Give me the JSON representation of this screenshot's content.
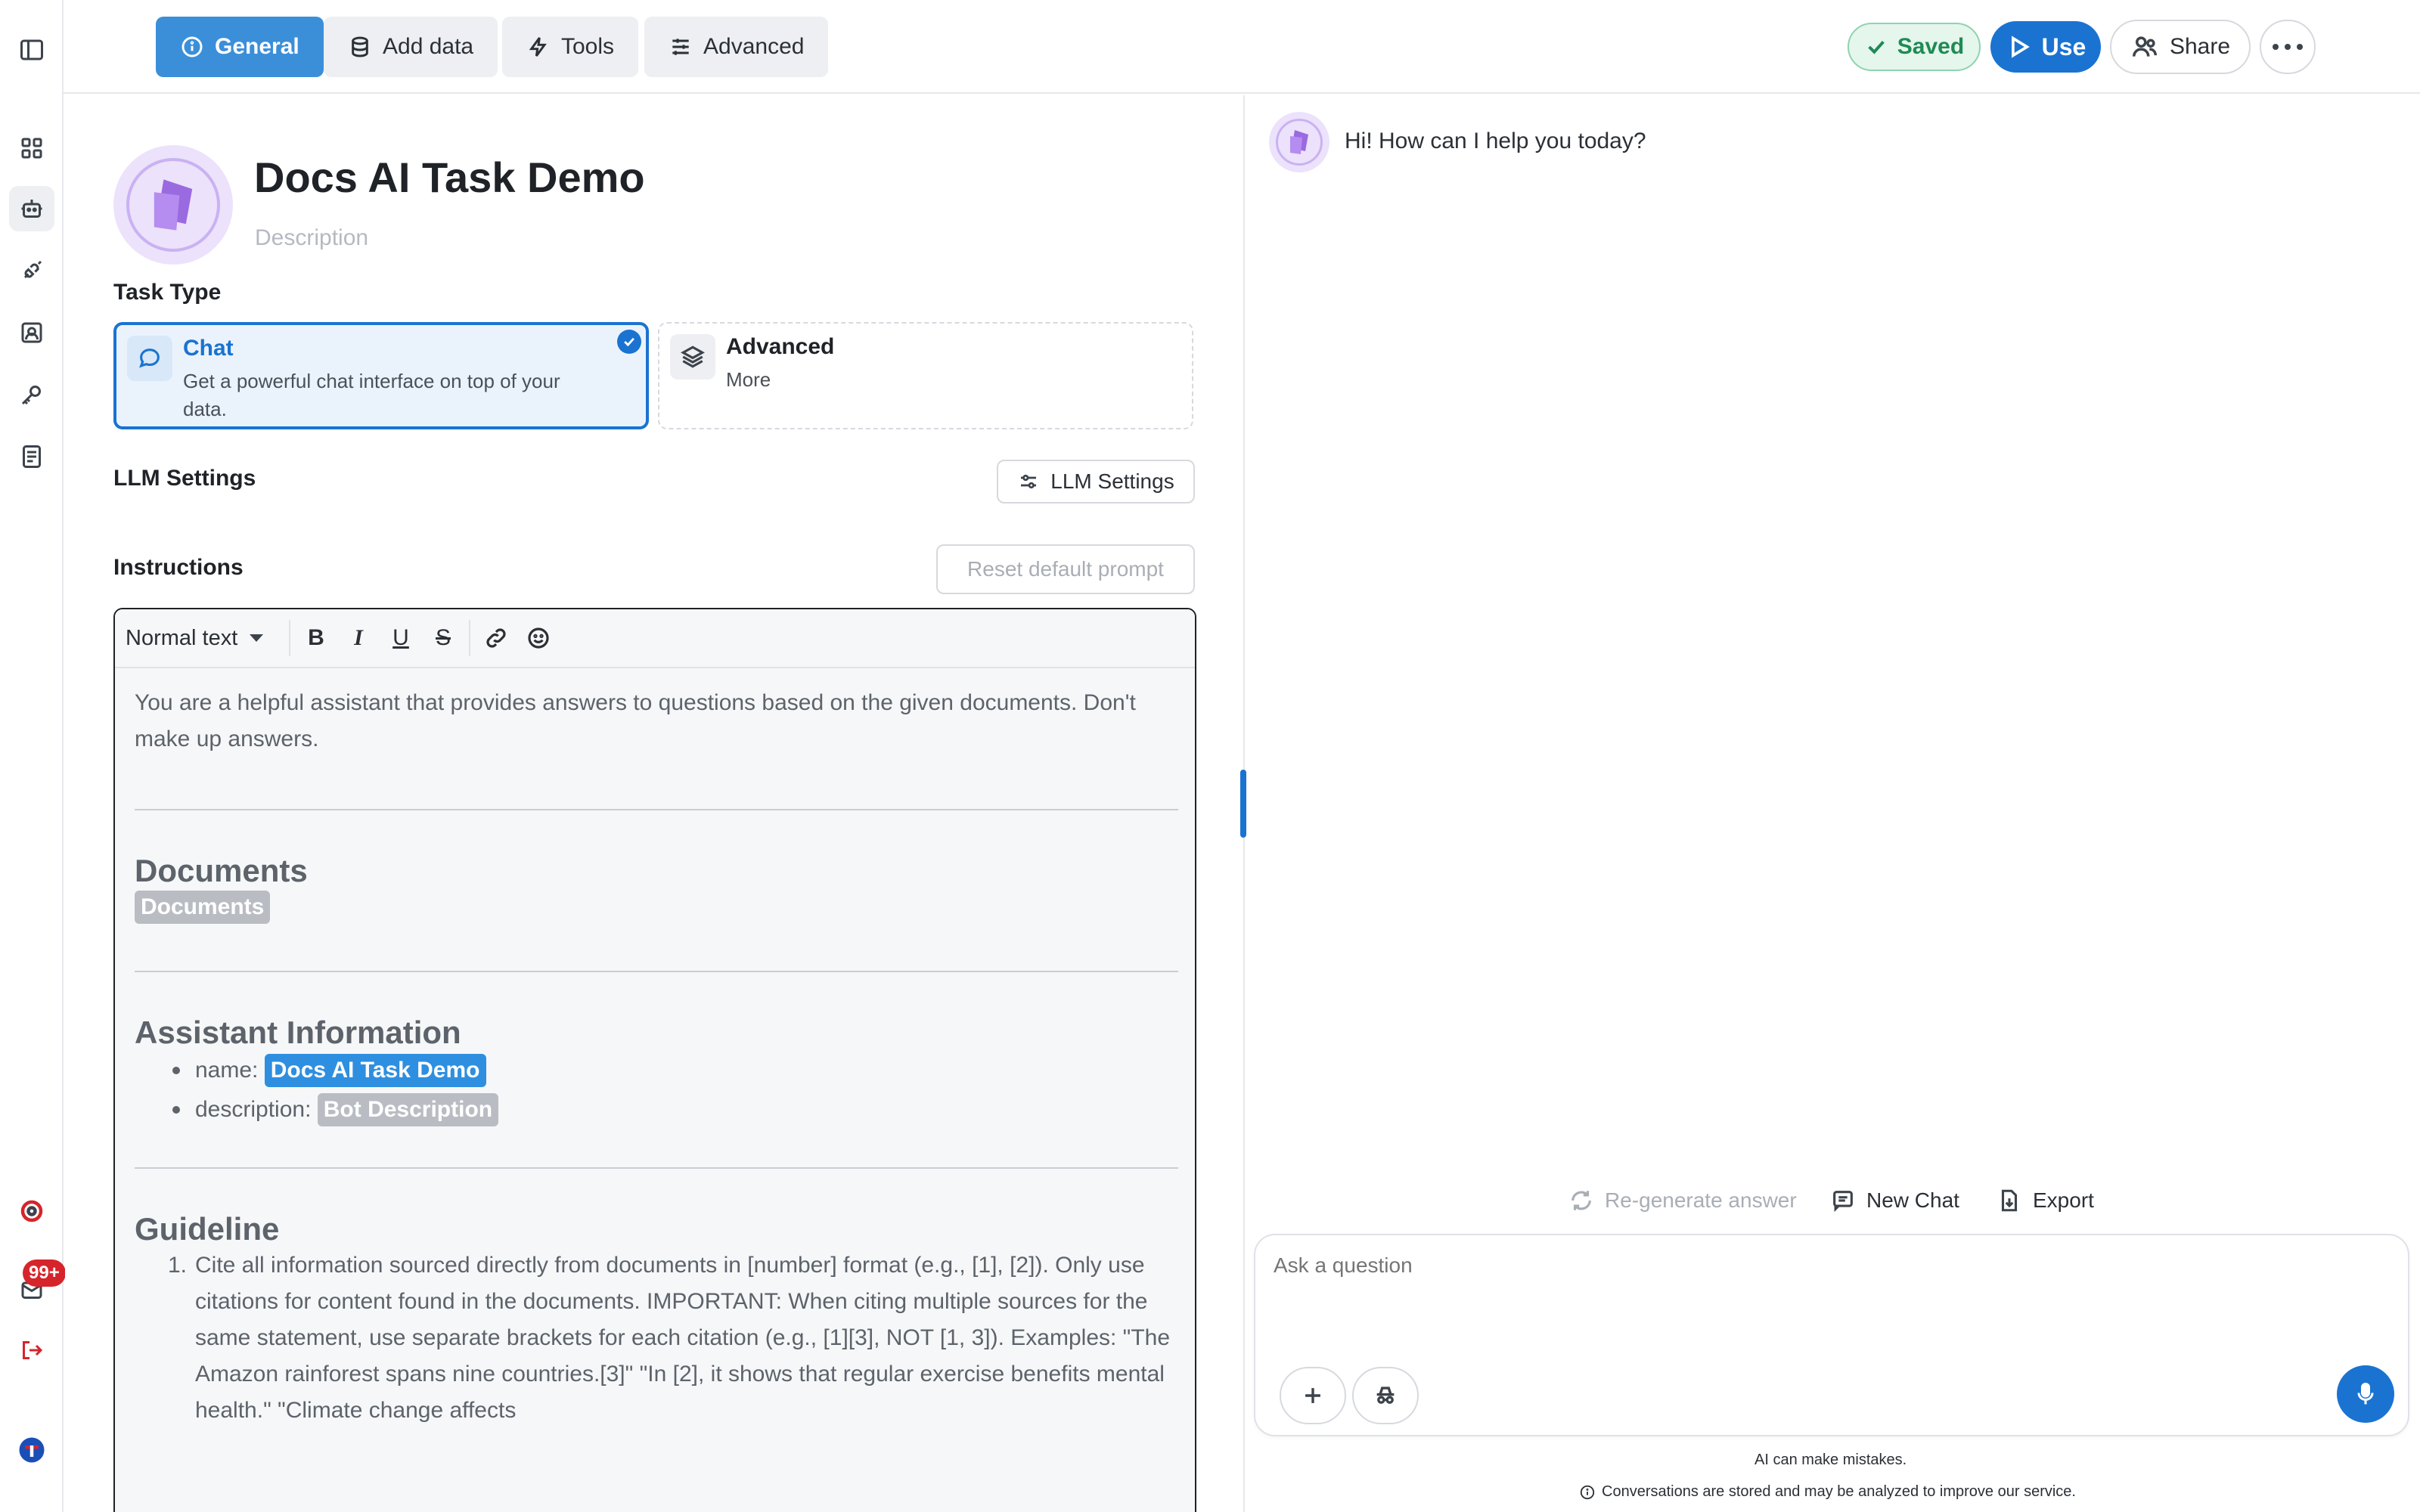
{
  "nav": {
    "tabs": [
      {
        "label": "General",
        "icon": "info-circle-icon",
        "active": true
      },
      {
        "label": "Add data",
        "icon": "database-icon",
        "active": false
      },
      {
        "label": "Tools",
        "icon": "lightning-icon",
        "active": false
      },
      {
        "label": "Advanced",
        "icon": "sliders-icon",
        "active": false
      }
    ],
    "saved_label": "Saved",
    "use_label": "Use",
    "share_label": "Share",
    "notifications_count": "99+"
  },
  "bot": {
    "title": "Docs AI Task Demo",
    "description_placeholder": "Description"
  },
  "task_type": {
    "label": "Task Type",
    "options": [
      {
        "name": "Chat",
        "description": "Get a powerful chat interface on top of your data.",
        "selected": true
      },
      {
        "name": "Advanced",
        "description": "More",
        "selected": false
      }
    ]
  },
  "llm": {
    "label": "LLM Settings",
    "button_label": "LLM Settings"
  },
  "instructions": {
    "label": "Instructions",
    "reset_label": "Reset default prompt",
    "text_style": "Normal text",
    "toolbar": {
      "bold": "B",
      "italic": "I",
      "underline": "U",
      "strike": "S"
    },
    "intro": "You are a helpful assistant that provides answers to questions based on the given documents. Don't make up answers.",
    "documents_heading": "Documents",
    "documents_chip": "Documents",
    "assistant_heading": "Assistant Information",
    "assistant_fields": [
      {
        "key": "name:",
        "value": "Docs AI Task Demo"
      },
      {
        "key": "description:",
        "value": "Bot Description"
      }
    ],
    "guideline_heading": "Guideline",
    "guideline_item_number": "1.",
    "guideline_item_text": "Cite all information sourced directly from documents in [number] format (e.g., [1], [2]). Only use citations for content found in the documents. IMPORTANT: When citing multiple sources for the same statement, use separate brackets for each citation (e.g., [1][3], NOT [1, 3]). Examples: \"The Amazon rainforest spans nine countries.[3]\" \"In [2], it shows that regular exercise benefits mental health.\" \"Climate change affects"
  },
  "chat": {
    "greeting": "Hi! How can I help you today?",
    "regenerate_label": "Re-generate answer",
    "new_chat_label": "New Chat",
    "export_label": "Export",
    "input_placeholder": "Ask a question",
    "disclaimer": "AI can make mistakes.",
    "privacy_note": "Conversations are stored and may be analyzed to improve our service."
  },
  "colors": {
    "accent": "#1a73d1",
    "tab_active": "#3b8fd9",
    "saved_green": "#1f8a55",
    "badge_red": "#d6242b",
    "bot_avatar_purple": "#ece2fb"
  }
}
